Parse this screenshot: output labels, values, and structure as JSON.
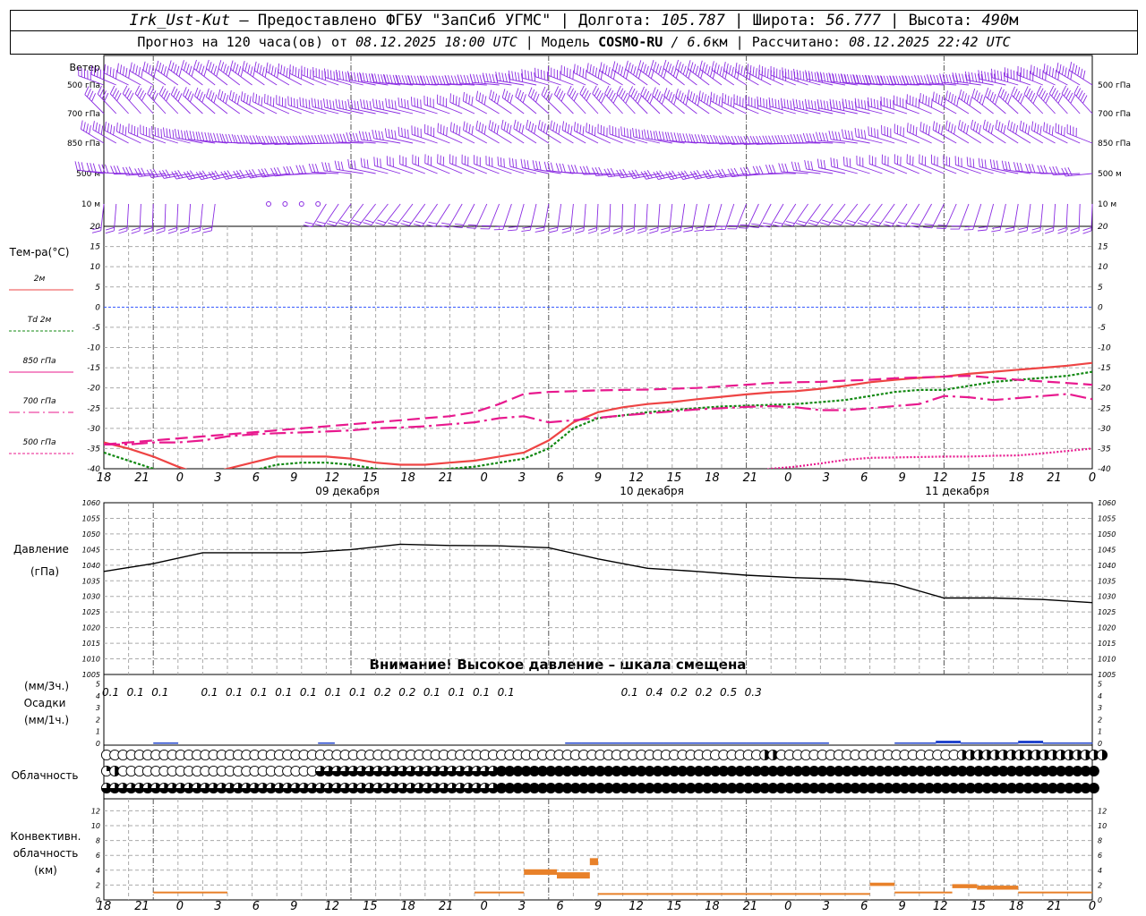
{
  "header": {
    "station": "Irk_Ust-Kut",
    "provider_sep": "–",
    "provider": "Предоставлено ФГБУ \"ЗапСиб УГМС\"",
    "lon_label": "Долгота:",
    "lon_value": "105.787",
    "lat_label": "Широта:",
    "lat_value": "56.777",
    "alt_label": "Высота:",
    "alt_value": "490",
    "alt_unit": "м",
    "forecast_prefix": "Прогноз на 120 часа(ов) от",
    "forecast_start": "08.12.2025 18:00 UTC",
    "model_label": "Модель",
    "model_name": "COSMO-RU",
    "model_res_sep": "/",
    "model_res": "6.6",
    "model_res_unit": "км",
    "calc_label": "Рассчитано:",
    "calc_time": "08.12.2025 22:42 UTC"
  },
  "wind": {
    "title": "Ветер",
    "levels": [
      "500 гПа",
      "700 гПа",
      "850 гПа",
      "500 м",
      "10 м"
    ],
    "colors": {
      "barb": "#8a2be2"
    }
  },
  "time_axis": {
    "hour_labels": [
      "18",
      "21",
      "0",
      "3",
      "6",
      "9",
      "12",
      "15",
      "18",
      "21",
      "0",
      "3",
      "6",
      "9",
      "12",
      "15",
      "18",
      "21",
      "0",
      "3",
      "6",
      "9",
      "12",
      "15",
      "18",
      "21",
      "0"
    ],
    "day_labels": [
      "09 декабря",
      "10 декабря",
      "11 декабря"
    ]
  },
  "chart_data": [
    {
      "type": "line",
      "title": "Тем-ра(°C)",
      "ylim": [
        -40,
        20
      ],
      "y_ticks": [
        20,
        15,
        10,
        5,
        0,
        -5,
        -10,
        -15,
        -20,
        -25,
        -30,
        -35,
        -40
      ],
      "grid": true,
      "x_hours": [
        0,
        3,
        6,
        9,
        12,
        15,
        18,
        21,
        24,
        27,
        30,
        33,
        36,
        39,
        42,
        45,
        48,
        51,
        54,
        57,
        60,
        63,
        66,
        69,
        72,
        75,
        78,
        81,
        84,
        87,
        90,
        93,
        96,
        99,
        102,
        105,
        108,
        111,
        114,
        117,
        120
      ],
      "series": [
        {
          "name": "2м",
          "color": "#ee4444",
          "values": [
            -33.5,
            -35,
            -37,
            -39.5,
            -41.5,
            -40,
            -38.5,
            -37,
            -37,
            -37,
            -37.5,
            -38.5,
            -39,
            -39,
            -38.5,
            -38,
            -37,
            -36,
            -33,
            -28.5,
            -26,
            -24.8,
            -24,
            -23.5,
            -22.8,
            -22.2,
            -21.6,
            -21.1,
            -20.8,
            -20.2,
            -19.5,
            -18.6,
            -18,
            -17.5,
            -17.2,
            -16.5,
            -16,
            -15.5,
            -15,
            -14.5,
            -13.8
          ]
        },
        {
          "name": "Td 2м",
          "color": "#118811",
          "values": [
            -36,
            -38,
            -40,
            -42,
            -43,
            -42,
            -40.5,
            -39,
            -38.5,
            -38.5,
            -39,
            -40,
            -40.5,
            -40.5,
            -40,
            -39.5,
            -38.5,
            -37.5,
            -35,
            -30,
            -27.5,
            -26.8,
            -26,
            -25.5,
            -25,
            -24.6,
            -24.4,
            -24.2,
            -24,
            -23.5,
            -23,
            -22,
            -21,
            -20.5,
            -20.5,
            -19.5,
            -18.5,
            -18,
            -17.5,
            -17,
            -16
          ]
        },
        {
          "name": "850 гПа",
          "color": "#e8198e",
          "values": [
            -34,
            -33.5,
            -33,
            -32.5,
            -32,
            -31.5,
            -31,
            -30.5,
            -30,
            -29.5,
            -29,
            -28.5,
            -28,
            -27.5,
            -27,
            -26,
            -24,
            -21.5,
            -21,
            -20.8,
            -20.6,
            -20.5,
            -20.4,
            -20.2,
            -20,
            -19.6,
            -19.2,
            -18.8,
            -18.6,
            -18.5,
            -18.2,
            -18,
            -17.6,
            -17.4,
            -17.2,
            -17,
            -17.5,
            -18,
            -18.4,
            -18.8,
            -19.2
          ]
        },
        {
          "name": "700 гПа",
          "color": "#e8198e",
          "values": [
            -34,
            -34,
            -33.5,
            -33.5,
            -33,
            -32,
            -31.5,
            -31.2,
            -31,
            -30.8,
            -30.5,
            -30,
            -29.8,
            -29.5,
            -29,
            -28.5,
            -27.5,
            -27,
            -28.5,
            -28,
            -27.4,
            -26.8,
            -26.3,
            -25.8,
            -25.3,
            -25,
            -24.7,
            -24.5,
            -24.8,
            -25.5,
            -25.5,
            -25,
            -24.5,
            -24,
            -22,
            -22.3,
            -23,
            -22.5,
            -22,
            -21.5,
            -22.8
          ]
        },
        {
          "name": "500 гПа",
          "color": "#e8198e",
          "values": [
            null,
            null,
            null,
            null,
            null,
            null,
            null,
            null,
            null,
            null,
            null,
            null,
            null,
            null,
            null,
            null,
            null,
            null,
            null,
            null,
            null,
            null,
            null,
            null,
            null,
            null,
            -41,
            -40,
            -39.5,
            -38.7,
            -37.8,
            -37.3,
            -37.2,
            -37.1,
            -37,
            -37,
            -36.8,
            -36.7,
            -36.2,
            -35.6,
            -35
          ]
        }
      ]
    },
    {
      "type": "line",
      "title": "Давление",
      "ylabel": "(гПа)",
      "ylim": [
        1005,
        1060
      ],
      "y_ticks": [
        1060,
        1055,
        1050,
        1045,
        1040,
        1035,
        1030,
        1025,
        1020,
        1015,
        1010,
        1005
      ],
      "grid": true,
      "annotation": "Внимание! Высокое давление – шкала смещена",
      "x_hours": [
        0,
        6,
        12,
        18,
        24,
        30,
        36,
        42,
        48,
        54,
        60,
        66,
        72,
        78,
        84,
        90,
        96,
        102,
        108,
        114,
        120
      ],
      "series": [
        {
          "name": "",
          "color": "#000000",
          "values": [
            1038,
            1040.5,
            1044,
            1044,
            1044,
            1045,
            1046.7,
            1046.3,
            1046.2,
            1045.6,
            1042,
            1039,
            1038,
            1036.8,
            1036,
            1035.5,
            1034,
            1029.5,
            1029.5,
            1029,
            1028
          ]
        }
      ]
    },
    {
      "type": "bar",
      "title": "Осадки",
      "ylabel_left": "(мм/3ч.)",
      "ylabel_left2": "(мм/1ч.)",
      "ylim": [
        0,
        5
      ],
      "y_ticks": [
        5,
        4,
        3,
        2,
        1,
        0
      ],
      "labels_3h": [
        "0.1",
        "0.1",
        "0.1",
        "",
        "0.1",
        "0.1",
        "0.1",
        "0.1",
        "0.1",
        "0.1",
        "0.1",
        "0.2",
        "0.2",
        "0.1",
        "0.1",
        "0.1",
        "0.1",
        "",
        "",
        "0.1",
        "0.4",
        "0.2",
        "0.2",
        "0.5",
        "0.3"
      ],
      "label_hours": [
        3,
        6,
        9,
        12,
        15,
        18,
        21,
        24,
        27,
        30,
        33,
        36,
        39,
        42,
        45,
        48,
        51,
        54,
        57,
        66,
        69,
        72,
        75,
        78,
        81
      ],
      "color": "#2244cc"
    },
    {
      "type": "table",
      "title": "Облачность",
      "rows": 3,
      "x_step_hours": 1,
      "row_levels": [
        [
          0,
          0,
          0,
          0,
          0,
          0,
          0,
          0,
          0,
          0,
          0,
          0,
          0,
          0,
          0,
          0,
          0,
          0,
          0,
          0,
          0,
          0,
          0,
          0,
          0,
          0,
          0,
          0,
          0,
          0,
          0,
          0,
          0,
          0,
          0,
          0,
          0,
          0,
          0,
          0,
          0,
          0,
          0,
          0,
          0,
          0,
          0,
          0,
          0,
          0,
          0,
          0,
          0,
          0,
          0,
          0,
          0,
          0,
          0,
          0,
          0,
          0,
          0,
          0,
          0,
          0,
          0,
          0,
          0,
          0,
          0,
          0,
          0,
          0,
          0,
          0,
          0,
          0,
          0,
          0,
          2,
          2,
          0,
          0,
          0,
          0,
          0,
          0,
          0,
          0,
          0,
          0,
          0,
          0,
          0,
          0,
          0,
          0,
          0,
          0,
          0,
          0,
          0,
          0,
          2,
          2,
          2,
          2,
          2,
          2,
          2,
          2,
          2,
          2,
          2,
          2,
          2,
          2,
          2,
          2,
          2,
          2
        ],
        [
          1,
          2,
          0,
          0,
          0,
          0,
          0,
          0,
          0,
          0,
          0,
          0,
          0,
          0,
          0,
          0,
          0,
          0,
          0,
          0,
          0,
          0,
          0,
          0,
          0,
          0,
          3,
          3,
          3,
          3,
          3,
          3,
          3,
          3,
          3,
          3,
          3,
          3,
          3,
          3,
          3,
          3,
          3,
          3,
          3,
          3,
          3,
          3,
          4,
          4,
          4,
          4,
          4,
          4,
          4,
          4,
          4,
          4,
          4,
          4,
          4,
          4,
          4,
          4,
          4,
          4,
          4,
          4,
          4,
          4,
          4,
          4,
          4,
          4,
          4,
          4,
          4,
          4,
          4,
          4,
          4,
          4,
          4,
          4,
          4,
          4,
          4,
          4,
          4,
          4,
          4,
          4,
          4,
          4,
          4,
          4,
          4,
          4,
          4,
          4,
          4,
          4,
          4,
          4,
          4,
          4,
          4,
          4,
          4,
          4,
          4,
          4,
          4,
          4,
          4,
          4,
          4,
          4,
          4,
          4,
          4
        ],
        [
          3,
          3,
          3,
          3,
          3,
          3,
          3,
          3,
          3,
          3,
          3,
          3,
          3,
          3,
          3,
          3,
          3,
          3,
          3,
          3,
          3,
          3,
          3,
          3,
          3,
          3,
          3,
          3,
          3,
          3,
          3,
          3,
          3,
          3,
          3,
          3,
          3,
          3,
          3,
          3,
          3,
          3,
          3,
          3,
          3,
          3,
          3,
          3,
          4,
          4,
          4,
          4,
          4,
          4,
          4,
          4,
          4,
          4,
          4,
          4,
          4,
          4,
          4,
          4,
          4,
          4,
          4,
          4,
          4,
          4,
          4,
          4,
          4,
          4,
          4,
          4,
          4,
          4,
          4,
          4,
          4,
          4,
          4,
          4,
          4,
          4,
          4,
          4,
          4,
          4,
          4,
          4,
          4,
          4,
          4,
          4,
          4,
          4,
          4,
          4,
          4,
          4,
          4,
          4,
          4,
          4,
          4,
          4,
          4,
          4,
          4,
          4,
          4,
          4,
          4,
          4,
          4,
          4,
          4,
          4,
          4
        ]
      ]
    },
    {
      "type": "bar",
      "title": "Конвективн.",
      "title2": "облачность",
      "ylabel": "(км)",
      "ylim": [
        0,
        13
      ],
      "y_ticks": [
        12,
        10,
        8,
        6,
        4,
        2,
        0
      ],
      "color": "#e8812a",
      "segments": [
        {
          "h0": 6,
          "h1": 15,
          "bottom": 1.0,
          "top": 1.0
        },
        {
          "h0": 45,
          "h1": 51,
          "bottom": 1.0,
          "top": 1.0
        },
        {
          "h0": 51,
          "h1": 55,
          "bottom": 3.5,
          "top": 4.0
        },
        {
          "h0": 55,
          "h1": 59,
          "bottom": 3.0,
          "top": 3.6
        },
        {
          "h0": 59,
          "h1": 60,
          "bottom": 4.8,
          "top": 5.5
        },
        {
          "h0": 60,
          "h1": 93,
          "bottom": 0.8,
          "top": 0.8
        },
        {
          "h0": 93,
          "h1": 96,
          "bottom": 2.0,
          "top": 2.2
        },
        {
          "h0": 96,
          "h1": 103,
          "bottom": 1.0,
          "top": 1.0
        },
        {
          "h0": 103,
          "h1": 106,
          "bottom": 1.7,
          "top": 2.0
        },
        {
          "h0": 106,
          "h1": 111,
          "bottom": 1.5,
          "top": 1.8
        },
        {
          "h0": 111,
          "h1": 120,
          "bottom": 1.0,
          "top": 1.0
        }
      ]
    }
  ]
}
